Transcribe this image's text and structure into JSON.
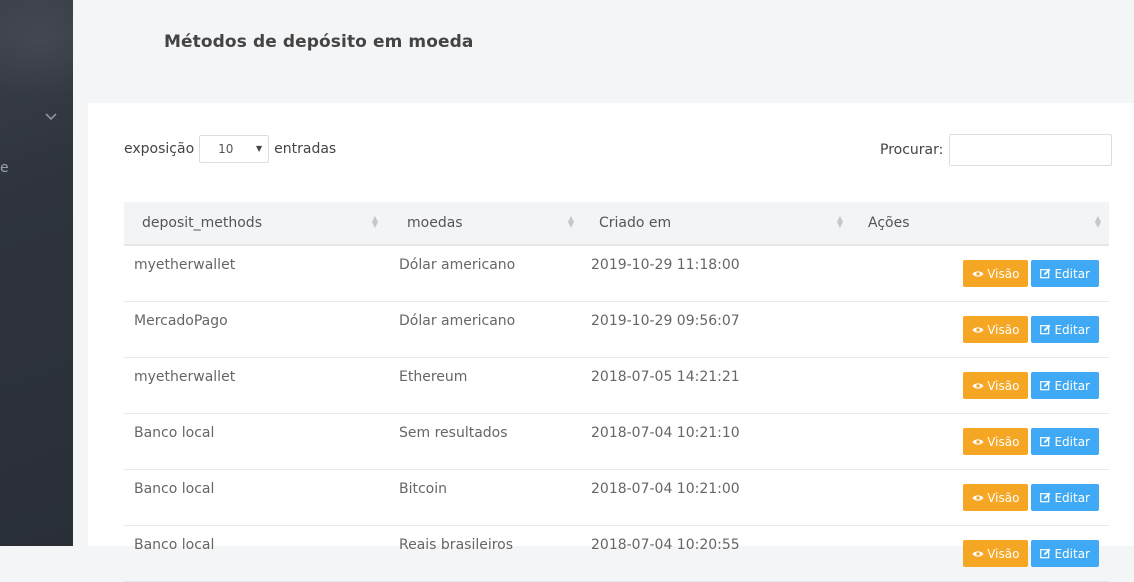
{
  "page": {
    "title": "Métodos de depósito em moeda"
  },
  "sidebar": {
    "cut_text": "e"
  },
  "table_controls": {
    "length_prefix": "exposição",
    "length_value": "10",
    "length_suffix": "entradas",
    "search_label": "Procurar:",
    "search_value": ""
  },
  "table": {
    "headers": [
      "deposit_methods",
      "moedas",
      "Criado em",
      "Ações"
    ],
    "rows": [
      {
        "method": "myetherwallet",
        "currency": "Dólar americano",
        "created": "2019-10-29 11:18:00"
      },
      {
        "method": "MercadoPago",
        "currency": "Dólar americano",
        "created": "2019-10-29 09:56:07"
      },
      {
        "method": "myetherwallet",
        "currency": "Ethereum",
        "created": "2018-07-05 14:21:21"
      },
      {
        "method": "Banco local",
        "currency": "Sem resultados",
        "created": "2018-07-04 10:21:10"
      },
      {
        "method": "Banco local",
        "currency": "Bitcoin",
        "created": "2018-07-04 10:21:00"
      },
      {
        "method": "Banco local",
        "currency": "Reais brasileiros",
        "created": "2018-07-04 10:20:55"
      }
    ],
    "view_label": "Visão",
    "edit_label": "Editar"
  },
  "colors": {
    "view_button": "#f5a623",
    "edit_button": "#3fa9f5",
    "sidebar": "#2f343c"
  },
  "icons": {
    "view": "eye-icon",
    "edit": "edit-icon",
    "sort": "sort-icon",
    "sidebar_toggle": "chevron-down-icon"
  }
}
